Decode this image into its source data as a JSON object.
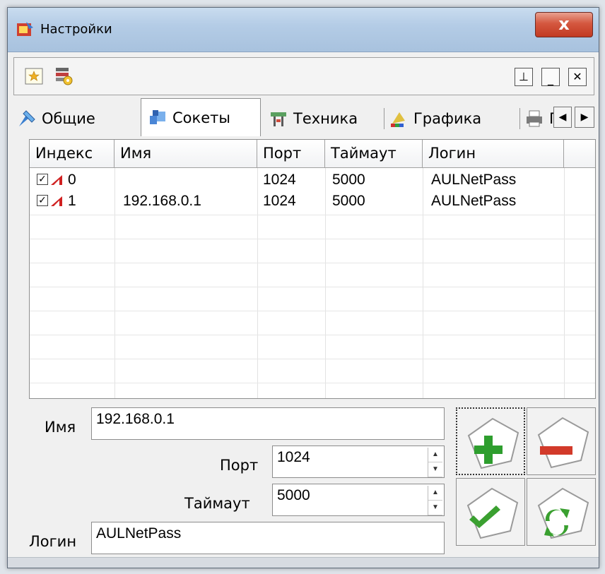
{
  "window": {
    "title": "Настройки",
    "close_label": "x"
  },
  "toolbar": {
    "icons": [
      "favorites-icon",
      "network-settings-icon"
    ],
    "window_buttons": [
      "restore-icon",
      "minimize-icon",
      "close-icon"
    ]
  },
  "tabs": [
    {
      "label": "Общие",
      "icon": "general-settings-icon",
      "active": false
    },
    {
      "label": "Сокеты",
      "icon": "sockets-icon",
      "active": true
    },
    {
      "label": "Техника",
      "icon": "machinery-icon",
      "active": false
    },
    {
      "label": "Графика",
      "icon": "graphics-icon",
      "active": false
    },
    {
      "label": "Г",
      "icon": "printer-icon",
      "active": false
    }
  ],
  "grid": {
    "columns": [
      "Индекс",
      "Имя",
      "Порт",
      "Таймаут",
      "Логин"
    ],
    "rows": [
      {
        "checked": true,
        "index": "0",
        "name": "",
        "port": "1024",
        "timeout": "5000",
        "login": "AULNetPass"
      },
      {
        "checked": true,
        "index": "1",
        "name": "192.168.0.1",
        "port": "1024",
        "timeout": "5000",
        "login": "AULNetPass"
      }
    ]
  },
  "form": {
    "name_label": "Имя",
    "name_value": "192.168.0.1",
    "port_label": "Порт",
    "port_value": "1024",
    "timeout_label": "Таймаут",
    "timeout_value": "5000",
    "login_label": "Логин",
    "login_value": "AULNetPass"
  },
  "buttons": [
    "add-button",
    "remove-button",
    "apply-button",
    "refresh-button"
  ],
  "colors": {
    "add": "#2e9e2e",
    "remove": "#d23a2a",
    "titlebar": "#b4cce6"
  }
}
